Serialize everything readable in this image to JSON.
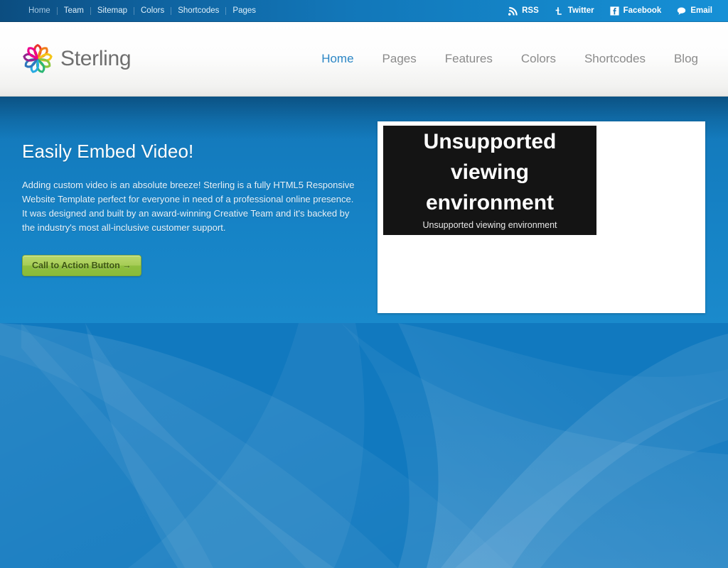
{
  "topbar": {
    "links": [
      {
        "label": "Home",
        "active": true
      },
      {
        "label": "Team",
        "active": false
      },
      {
        "label": "Sitemap",
        "active": false
      },
      {
        "label": "Colors",
        "active": false
      },
      {
        "label": "Shortcodes",
        "active": false
      },
      {
        "label": "Pages",
        "active": false
      }
    ],
    "social": [
      {
        "label": "RSS",
        "icon": "rss-icon"
      },
      {
        "label": "Twitter",
        "icon": "twitter-icon"
      },
      {
        "label": "Facebook",
        "icon": "facebook-icon"
      },
      {
        "label": "Email",
        "icon": "email-bubble-icon"
      }
    ]
  },
  "header": {
    "logo_text": "Sterling",
    "logo_icon": "flower-logo-icon",
    "nav": [
      {
        "label": "Home",
        "active": true
      },
      {
        "label": "Pages",
        "active": false
      },
      {
        "label": "Features",
        "active": false
      },
      {
        "label": "Colors",
        "active": false
      },
      {
        "label": "Shortcodes",
        "active": false
      },
      {
        "label": "Blog",
        "active": false
      }
    ]
  },
  "hero": {
    "title": "Easily Embed Video!",
    "body": "Adding custom video is an absolute breeze! Sterling is a fully HTML5 Responsive Website Template perfect for everyone in need of a professional online presence. It was designed and built by an award-winning Creative Team and it's backed by the industry's most all-inclusive customer support.",
    "cta_label": "Call to Action Button →",
    "video": {
      "message": "Unsupported viewing environment",
      "caption": "Unsupported viewing environment"
    }
  },
  "colors": {
    "brand_blue": "#1179bf",
    "nav_active": "#2b86c5",
    "cta_green_light": "#b8d86b",
    "cta_green_dark": "#89bb39",
    "cta_text": "#3d5711",
    "topbar_dark": "#0c4d80",
    "topbar_light": "#1690d6",
    "logo_text_gray": "#6f6f6f",
    "video_bg": "#141414"
  }
}
